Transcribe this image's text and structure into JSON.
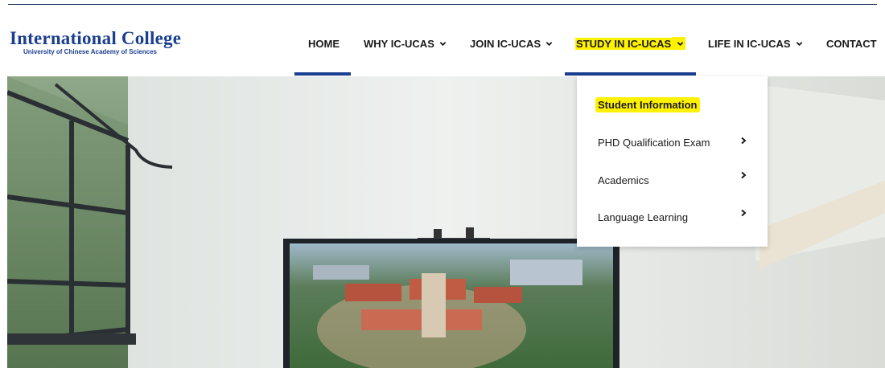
{
  "logo": {
    "title": "International College",
    "subtitle": "University of Chinese Academy of Sciences"
  },
  "nav": {
    "items": [
      {
        "label": "HOME",
        "has_dropdown": false
      },
      {
        "label": "WHY IC-UCAS",
        "has_dropdown": true
      },
      {
        "label": "JOIN IC-UCAS",
        "has_dropdown": true
      },
      {
        "label": "STUDY IN IC-UCAS",
        "has_dropdown": true,
        "highlighted": true
      },
      {
        "label": "LIFE IN IC-UCAS",
        "has_dropdown": true
      },
      {
        "label": "CONTACT",
        "has_dropdown": false
      }
    ]
  },
  "dropdown": {
    "items": [
      {
        "label": "Student Information",
        "highlighted": true,
        "has_submenu": false
      },
      {
        "label": "PHD Qualification Exam",
        "has_submenu": true
      },
      {
        "label": "Academics",
        "has_submenu": true
      },
      {
        "label": "Language Learning",
        "has_submenu": true
      }
    ]
  },
  "colors": {
    "brand_blue": "#1b3f8f",
    "highlight_yellow": "#fff200",
    "text": "#1a1a1a"
  }
}
